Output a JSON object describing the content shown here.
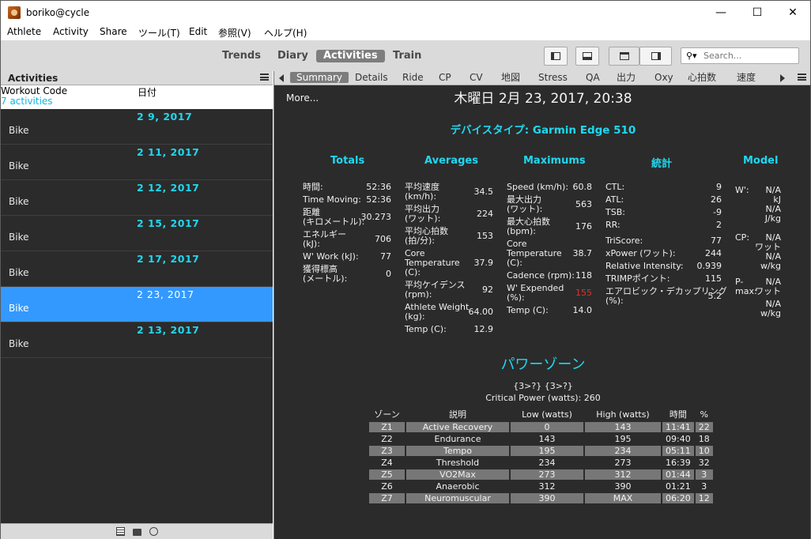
{
  "window": {
    "title": "boriko@cycle",
    "minimize": "—",
    "maximize": "☐",
    "close": "✕"
  },
  "menu": [
    "Athlete",
    "Activity",
    "Share",
    "ツール(T)",
    "Edit",
    "参照(V)",
    "ヘルプ(H)"
  ],
  "toolbar": {
    "views": [
      "Trends",
      "Diary",
      "Activities",
      "Train"
    ],
    "active_view": "Activities",
    "search_placeholder": "Search..."
  },
  "left_panel": {
    "title": "Activities",
    "col_workout_code": "Workout Code",
    "activity_count": "7 activities",
    "col_date": "日付",
    "activities": [
      {
        "date": "2 9, 2017",
        "sport": "Bike"
      },
      {
        "date": "2 11, 2017",
        "sport": "Bike"
      },
      {
        "date": "2 12, 2017",
        "sport": "Bike"
      },
      {
        "date": "2 15, 2017",
        "sport": "Bike"
      },
      {
        "date": "2 17, 2017",
        "sport": "Bike"
      },
      {
        "date": "2 23, 2017",
        "sport": "Bike",
        "selected": true
      },
      {
        "date": "2 13, 2017",
        "sport": "Bike"
      }
    ]
  },
  "tabs": [
    "Summary",
    "Details",
    "Ride",
    "CP",
    "CV",
    "地図",
    "Stress",
    "QA",
    "出力",
    "Oxy",
    "心拍数",
    "速度"
  ],
  "active_tab": "Summary",
  "summary": {
    "more": "More...",
    "heading": "木曜日 2月 23, 2017, 20:38",
    "device_type": "デバイスタイプ: Garmin Edge 510",
    "totals_title": "Totals",
    "averages_title": "Averages",
    "maximums_title": "Maximums",
    "stats_title": "統計",
    "model_title": "Model",
    "totals": [
      {
        "k": "時間:",
        "v": "52:36"
      },
      {
        "k": "Time Moving:",
        "v": "52:36"
      },
      {
        "k": "距離\n(キロメートル):",
        "v": "30.273"
      },
      {
        "k": "エネルギー\n(kJ):",
        "v": "706"
      },
      {
        "k": "W' Work (kJ):",
        "v": "77"
      },
      {
        "k": "獲得標高\n(メートル):",
        "v": "0"
      }
    ],
    "averages": [
      {
        "k": "平均速度\n(km/h):",
        "v": "34.5"
      },
      {
        "k": "平均出力\n(ワット):",
        "v": "224"
      },
      {
        "k": "平均心拍数\n(拍/分):",
        "v": "153"
      },
      {
        "k": "Core\nTemperature\n(C):",
        "v": "37.9"
      },
      {
        "k": "平均ケイデンス\n(rpm):",
        "v": "92"
      },
      {
        "k": "Athlete Weight\n(kg):",
        "v": "64.00"
      },
      {
        "k": "Temp (C):",
        "v": "12.9"
      }
    ],
    "maximums": [
      {
        "k": "Speed (km/h):",
        "v": "60.8"
      },
      {
        "k": "最大出力\n(ワット):",
        "v": "563"
      },
      {
        "k": "最大心拍数\n(bpm):",
        "v": "176"
      },
      {
        "k": "Core\nTemperature\n(C):",
        "v": "38.7"
      },
      {
        "k": "Cadence (rpm):",
        "v": "118"
      },
      {
        "k": "W' Expended\n(%):",
        "v": "155",
        "red": true
      },
      {
        "k": "Temp (C):",
        "v": "14.0"
      }
    ],
    "stats": [
      {
        "k": "CTL:",
        "v": "9"
      },
      {
        "k": "ATL:",
        "v": "26"
      },
      {
        "k": "TSB:",
        "v": "-9"
      },
      {
        "k": "RR:",
        "v": "2"
      },
      {
        "k": "TriScore:",
        "v": "77"
      },
      {
        "k": "xPower (ワット):",
        "v": "244"
      },
      {
        "k": "Relative Intensity:",
        "v": "0.939"
      },
      {
        "k": "TRIMPポイント:",
        "v": "115"
      },
      {
        "k": "エアロビック・デカップリング\n(%):",
        "v": "5.2"
      }
    ],
    "model": [
      {
        "k": "W':",
        "v": "N/A\nkJ"
      },
      {
        "k": "",
        "v": "N/A\nJ/kg"
      },
      {
        "k": "CP:",
        "v": "N/A\nワット"
      },
      {
        "k": "",
        "v": "N/A\nw/kg"
      },
      {
        "k": "P-\nmax:",
        "v": "N/A\nワット"
      },
      {
        "k": "",
        "v": "N/A\nw/kg"
      }
    ]
  },
  "power_zones": {
    "title": "パワーゾーン",
    "subtitle": "{3>?} {3>?}",
    "critical_power": "Critical Power (watts): 260",
    "headers": [
      "ゾーン",
      "説明",
      "Low (watts)",
      "High (watts)",
      "時間",
      "%"
    ],
    "rows": [
      [
        "Z1",
        "Active Recovery",
        "0",
        "143",
        "11:41",
        "22"
      ],
      [
        "Z2",
        "Endurance",
        "143",
        "195",
        "09:40",
        "18"
      ],
      [
        "Z3",
        "Tempo",
        "195",
        "234",
        "05:11",
        "10"
      ],
      [
        "Z4",
        "Threshold",
        "234",
        "273",
        "16:39",
        "32"
      ],
      [
        "Z5",
        "VO2Max",
        "273",
        "312",
        "01:44",
        "3"
      ],
      [
        "Z6",
        "Anaerobic",
        "312",
        "390",
        "01:21",
        "3"
      ],
      [
        "Z7",
        "Neuromuscular",
        "390",
        "MAX",
        "06:20",
        "12"
      ]
    ]
  }
}
